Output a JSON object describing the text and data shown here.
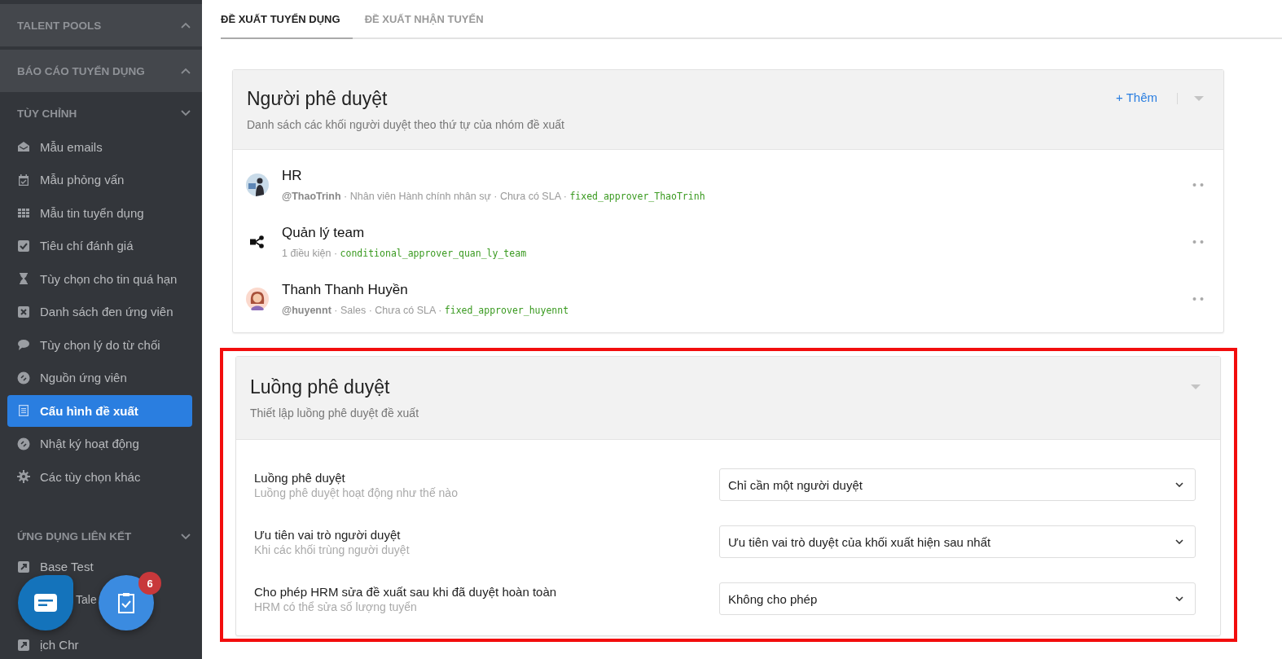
{
  "sidebar": {
    "sections": [
      {
        "title": "TALENT POOLS",
        "expanded": false
      },
      {
        "title": "BÁO CÁO TUYỂN DỤNG",
        "expanded": false
      },
      {
        "title": "TÙY CHỈNH",
        "expanded": true,
        "items": [
          {
            "label": "Mẫu emails",
            "selected": false
          },
          {
            "label": "Mẫu phỏng vấn",
            "selected": false
          },
          {
            "label": "Mẫu tin tuyển dụng",
            "selected": false
          },
          {
            "label": "Tiêu chí đánh giá",
            "selected": false
          },
          {
            "label": "Tùy chọn cho tin quá hạn",
            "selected": false
          },
          {
            "label": "Danh sách đen ứng viên",
            "selected": false
          },
          {
            "label": "Tùy chọn lý do từ chối",
            "selected": false
          },
          {
            "label": "Nguồn ứng viên",
            "selected": false
          },
          {
            "label": "Cấu hình đề xuất",
            "selected": true
          },
          {
            "label": "Nhật ký hoạt động",
            "selected": false
          },
          {
            "label": "Các tùy chọn khác",
            "selected": false
          }
        ]
      },
      {
        "title": "ỨNG DỤNG LIÊN KẾT",
        "expanded": true,
        "items": [
          {
            "label": "Base Test",
            "selected": false
          },
          {
            "label": "Tale",
            "selected": false
          },
          {
            "label": "ịch Chr",
            "selected": false
          }
        ]
      }
    ]
  },
  "floating": {
    "badge": "6"
  },
  "tabs": [
    {
      "label": "ĐỀ XUẤT TUYỂN DỤNG",
      "selected": true
    },
    {
      "label": "ĐỀ XUẤT NHẬN TUYỂN",
      "selected": false
    }
  ],
  "approvers": {
    "title": "Người phê duyệt",
    "subtitle": "Danh sách các khối người duyệt theo thứ tự của nhóm đề xuất",
    "add_button": "+ Thêm",
    "items": [
      {
        "name": "HR",
        "kind": "person",
        "handle": "@ThaoTrinh",
        "meta": " · Nhân viên Hành chính nhân sự · Chưa có SLA · ",
        "code": "fixed_approver_ThaoTrinh"
      },
      {
        "name": "Quản lý team",
        "kind": "conditional",
        "meta": "1 điều kiện · ",
        "code": "conditional_approver_quan_ly_team"
      },
      {
        "name": "Thanh Thanh Huyền",
        "kind": "avatar",
        "handle": "@huyennt",
        "meta": " · Sales · Chưa có SLA · ",
        "code": "fixed_approver_huyennt"
      }
    ]
  },
  "flow": {
    "title": "Luồng phê duyệt",
    "subtitle": "Thiết lập luồng phê duyệt đề xuất",
    "highlighted": true,
    "settings": [
      {
        "label": "Luồng phê duyệt",
        "hint": "Luồng phê duyệt hoạt động như thế nào",
        "value": "Chỉ cần một người duyệt"
      },
      {
        "label": "Ưu tiên vai trò người duyệt",
        "hint": "Khi các khối trùng người duyệt",
        "value": "Ưu tiên vai trò duyệt của khối xuất hiện sau nhất"
      },
      {
        "label": "Cho phép HRM sửa đề xuất sau khi đã duyệt hoàn toàn",
        "hint": "HRM có thể sửa số lượng tuyển",
        "value": "Không cho phép"
      }
    ]
  }
}
